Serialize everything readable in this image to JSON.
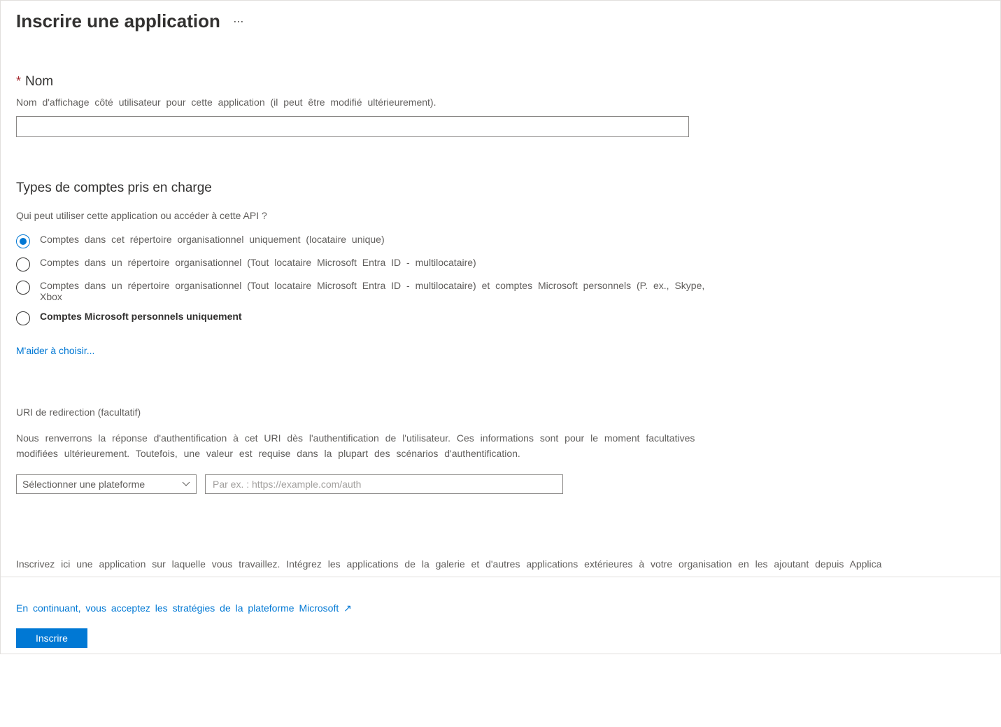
{
  "header": {
    "title": "Inscrire une application"
  },
  "name_section": {
    "label": "Nom",
    "hint": "Nom d'affichage côté utilisateur pour cette application (il peut être modifié ultérieurement).",
    "value": ""
  },
  "account_types": {
    "title": "Types de comptes pris en charge",
    "subtitle": "Qui peut utiliser cette application ou accéder à cette API ?",
    "options": [
      {
        "label": "Comptes dans cet répertoire organisationnel uniquement (locataire unique)",
        "selected": true
      },
      {
        "label": "Comptes dans un répertoire organisationnel (Tout locataire Microsoft Entra ID - multilocataire)",
        "selected": false
      },
      {
        "label": "Comptes dans un répertoire organisationnel (Tout locataire Microsoft Entra ID - multilocataire) et comptes Microsoft personnels (P. ex., Skype, Xbox",
        "selected": false
      },
      {
        "label": "Comptes Microsoft personnels uniquement",
        "selected": false
      }
    ],
    "help_link": "M'aider à choisir..."
  },
  "redirect": {
    "title": "URI de redirection (facultatif)",
    "description": "Nous renverrons la réponse d'authentification à cet URI dès l'authentification de l'utilisateur. Ces informations sont pour le moment facultatives modifiées ultérieurement. Toutefois, une valeur est requise dans la plupart des scénarios d'authentification.",
    "platform_placeholder": "Sélectionner une plateforme",
    "uri_placeholder": "Par ex. : https://example.com/auth"
  },
  "bottom_note": "Inscrivez ici une application sur laquelle vous travaillez. Intégrez les applications de la galerie et d'autres applications extérieures à votre organisation en les ajoutant depuis Applica",
  "footer": {
    "agreement": "En continuant, vous acceptez les stratégies de la plateforme Microsoft ↗",
    "submit": "Inscrire"
  }
}
